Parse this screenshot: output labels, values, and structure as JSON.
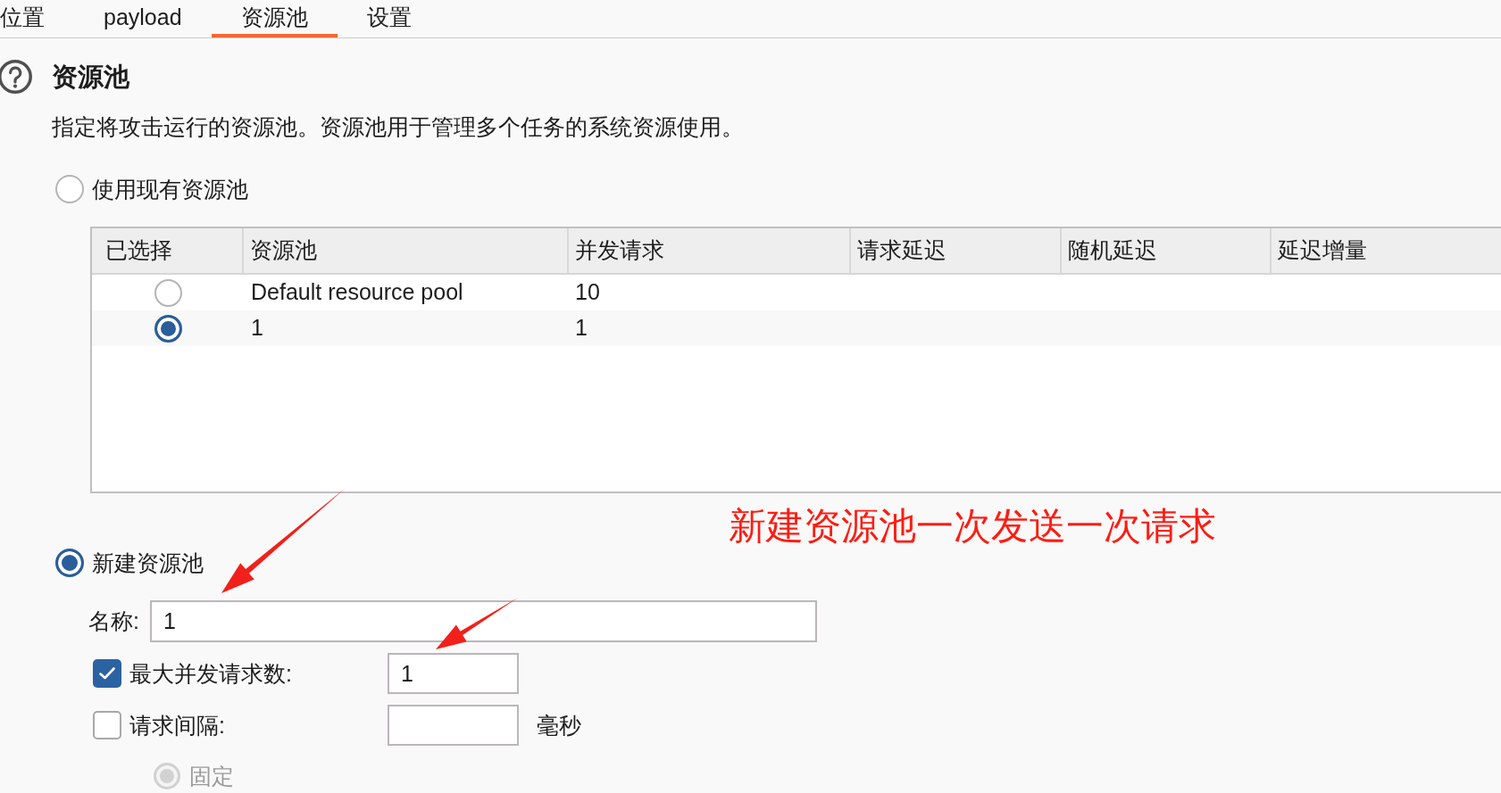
{
  "tabs": [
    {
      "label": "位置",
      "selected": false
    },
    {
      "label": "payload",
      "selected": false
    },
    {
      "label": "资源池",
      "selected": true
    },
    {
      "label": "设置",
      "selected": false
    }
  ],
  "section": {
    "title": "资源池",
    "description": "指定将攻击运行的资源池。资源池用于管理多个任务的系统资源使用。"
  },
  "pool_modes": [
    {
      "label": "使用现有资源池",
      "selected": false
    },
    {
      "label": "新建资源池",
      "selected": true
    }
  ],
  "table": {
    "columns": [
      "已选择",
      "资源池",
      "并发请求",
      "请求延迟",
      "随机延迟",
      "延迟增量"
    ],
    "rows": [
      {
        "selected": false,
        "resource_pool": "Default resource pool",
        "concurrent_requests": "10"
      },
      {
        "selected": true,
        "resource_pool": "1",
        "concurrent_requests": "1"
      }
    ]
  },
  "annotation": "新建资源池一次发送一次请求",
  "new_pool": {
    "name_label": "名称:",
    "name_value": "1",
    "settings": [
      {
        "label": "最大并发请求数:",
        "checked": true,
        "value": "1"
      },
      {
        "label": "请求间隔:",
        "checked": false,
        "unit": "毫秒",
        "options": [
          {
            "label": "固定",
            "selected": true,
            "disabled": true
          }
        ]
      }
    ]
  }
}
